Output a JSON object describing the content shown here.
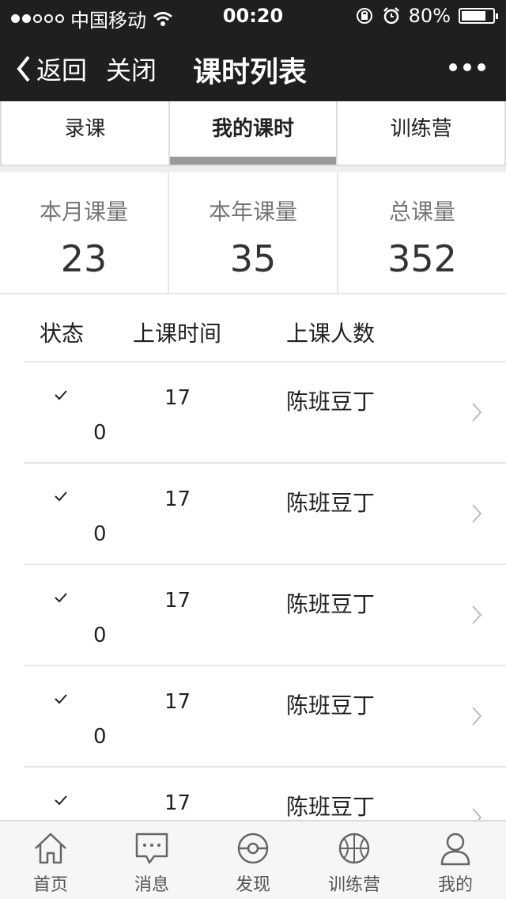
{
  "status_bar": {
    "carrier": "中国移动",
    "time": "00:20",
    "battery": "80%",
    "battery_level": 0.8
  },
  "nav": {
    "back_label": "返回",
    "close_label": "关闭",
    "title": "课时列表"
  },
  "tabs": [
    {
      "label": "录课",
      "active": false
    },
    {
      "label": "我的课时",
      "active": true
    },
    {
      "label": "训练营",
      "active": false
    }
  ],
  "stats": [
    {
      "label": "本月课量",
      "value": "23"
    },
    {
      "label": "本年课量",
      "value": "35"
    },
    {
      "label": "总课量",
      "value": "352"
    }
  ],
  "list": {
    "headers": {
      "status": "状态",
      "time": "上课时间",
      "count": "上课人数"
    },
    "rows": [
      {
        "status_icon": "check-icon",
        "time": "17",
        "time_extra": "0",
        "name": "陈班豆丁"
      },
      {
        "status_icon": "check-icon",
        "time": "17",
        "time_extra": "0",
        "name": "陈班豆丁"
      },
      {
        "status_icon": "check-icon",
        "time": "17",
        "time_extra": "0",
        "name": "陈班豆丁"
      },
      {
        "status_icon": "check-icon",
        "time": "17",
        "time_extra": "0",
        "name": "陈班豆丁"
      },
      {
        "status_icon": "check-icon",
        "time": "17",
        "time_extra": "",
        "name": "陈班豆丁"
      }
    ]
  },
  "tabbar": [
    {
      "label": "首页",
      "icon": "home-icon"
    },
    {
      "label": "消息",
      "icon": "message-icon"
    },
    {
      "label": "发现",
      "icon": "discover-icon"
    },
    {
      "label": "训练营",
      "icon": "basketball-icon"
    },
    {
      "label": "我的",
      "icon": "user-icon"
    }
  ]
}
